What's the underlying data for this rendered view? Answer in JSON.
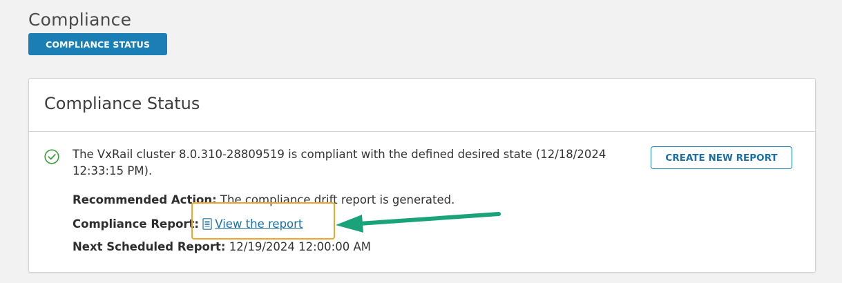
{
  "page": {
    "title": "Compliance",
    "tab_label": "COMPLIANCE STATUS"
  },
  "card": {
    "title": "Compliance Status",
    "status_icon": "check-circle-icon",
    "status_message": "The VxRail cluster 8.0.310-28809519 is compliant with the defined desired state (12/18/2024 12:33:15 PM).",
    "create_button_label": "CREATE NEW REPORT",
    "recommended_action_label": "Recommended Action:",
    "recommended_action_value": "The compliance drift report is generated.",
    "compliance_report_label": "Compliance Report:",
    "report_link_icon": "document-icon",
    "report_link_text": "View the report",
    "next_scheduled_label": "Next Scheduled Report:",
    "next_scheduled_value": "12/19/2024 12:00:00 AM"
  },
  "annotation": {
    "highlight_color": "#f0a52a",
    "arrow_color": "#1aa37a",
    "arrow_icon": "arrow-left-icon"
  },
  "colors": {
    "accent": "#1b7fb5",
    "success": "#3a9c3a",
    "background": "#f2f2f2"
  }
}
